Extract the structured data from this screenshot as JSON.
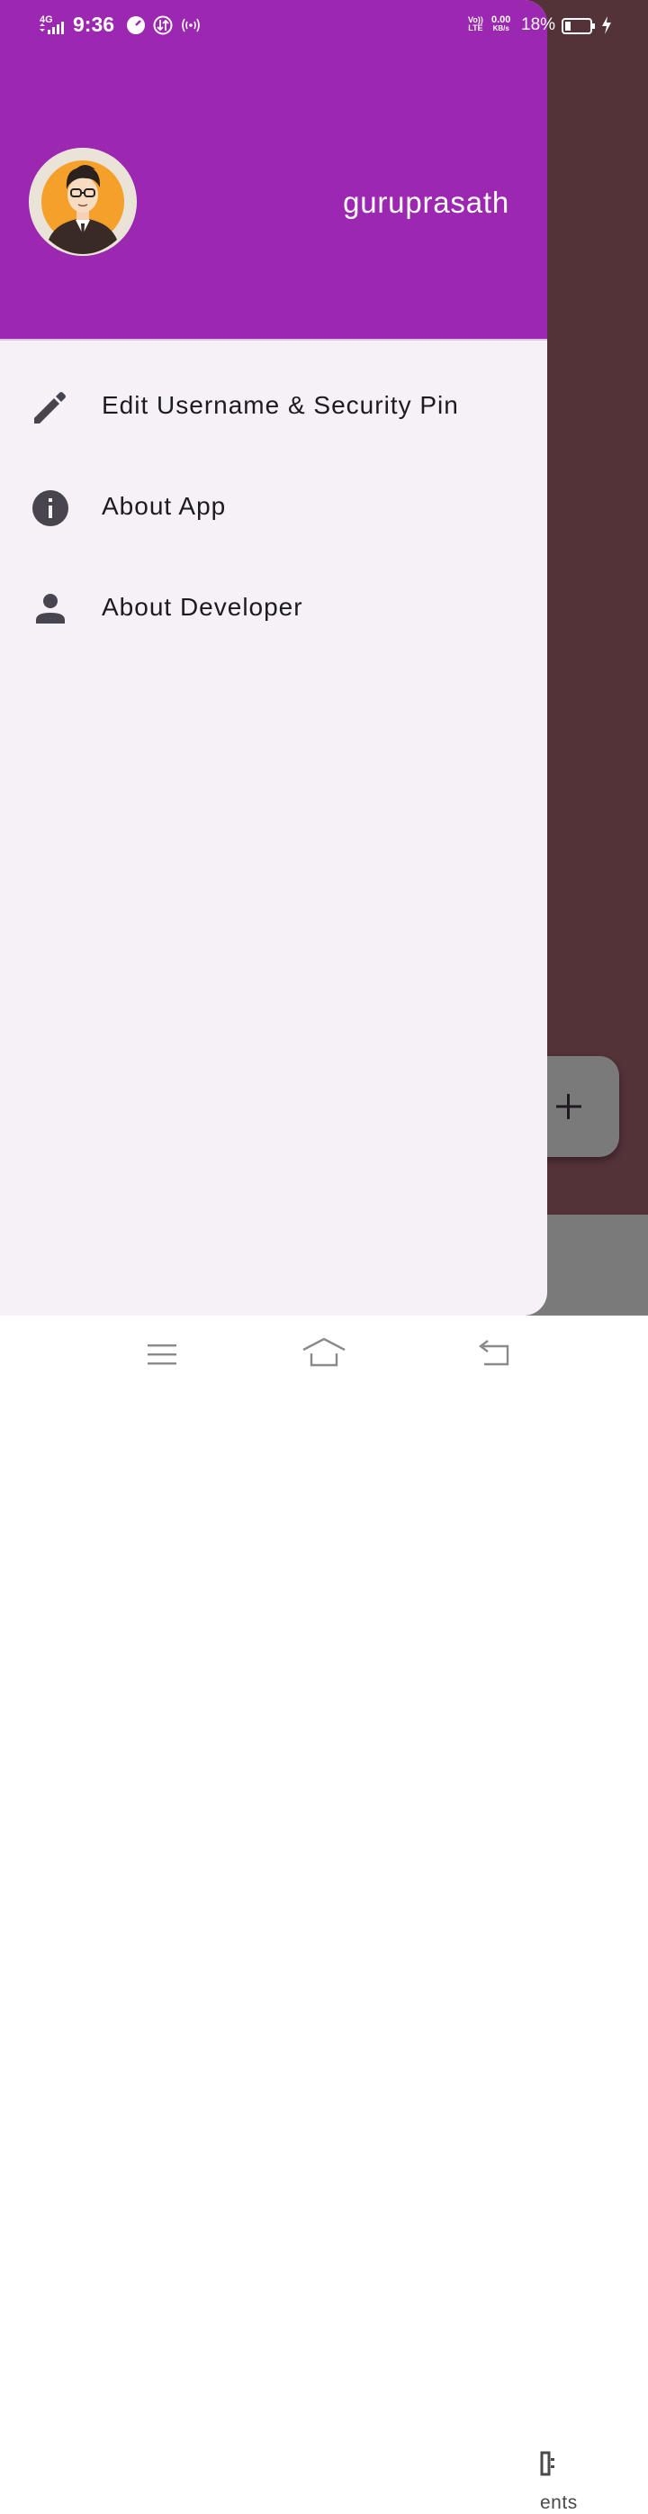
{
  "status_bar": {
    "network": "4G",
    "time": "9:36",
    "volte": [
      "Vo))",
      "LTE"
    ],
    "speed_value": "0.00",
    "speed_unit": "KB/s",
    "battery_percent": "18%",
    "icons": [
      "signal-icon",
      "speedometer-icon",
      "data-saver-icon",
      "hotspot-icon",
      "battery-icon",
      "charging-icon"
    ]
  },
  "drawer": {
    "header": {
      "username": "guruprasath",
      "avatar_icon": "developer-avatar",
      "background_color": "#9c27b0"
    },
    "menu": [
      {
        "label": "Edit Username & Security Pin",
        "icon": "pencil-icon"
      },
      {
        "label": "About App",
        "icon": "info-icon"
      },
      {
        "label": "About Developer",
        "icon": "person-icon"
      }
    ]
  },
  "background_app": {
    "fab_icon": "plus-icon",
    "bottom_nav_label_partial": "ents"
  },
  "system_nav": {
    "icons": [
      "menu-icon",
      "home-icon",
      "back-icon"
    ]
  }
}
